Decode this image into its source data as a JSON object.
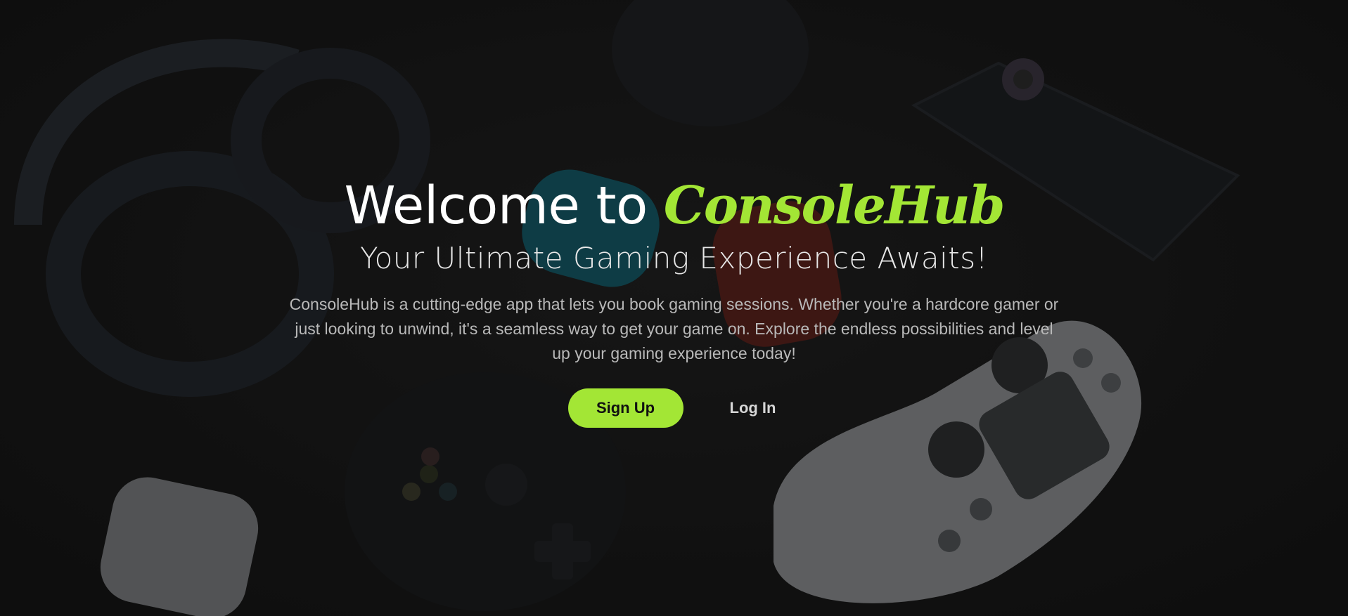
{
  "hero": {
    "headline_prefix": "Welcome to",
    "brand": "ConsoleHub",
    "subtitle": "Your Ultimate Gaming Experience Awaits!",
    "description": "ConsoleHub is a cutting-edge app that lets you book gaming sessions. Whether you're a hardcore gamer or just looking to unwind, it's a seamless way to get your game on. Explore the endless possibilities and level up your gaming experience today!",
    "signup_label": "Sign Up",
    "login_label": "Log In"
  },
  "colors": {
    "accent": "#a3e635",
    "background": "#141414",
    "text_primary": "#ffffff",
    "text_muted": "#b9b9b9"
  },
  "background_image": {
    "icons": [
      "headphones-icon",
      "joycon-blue-icon",
      "joycon-red-icon",
      "gamepad-xbox-icon",
      "gamepad-playstation-icon",
      "earbuds-case-icon",
      "light-panel-device-icon"
    ]
  }
}
